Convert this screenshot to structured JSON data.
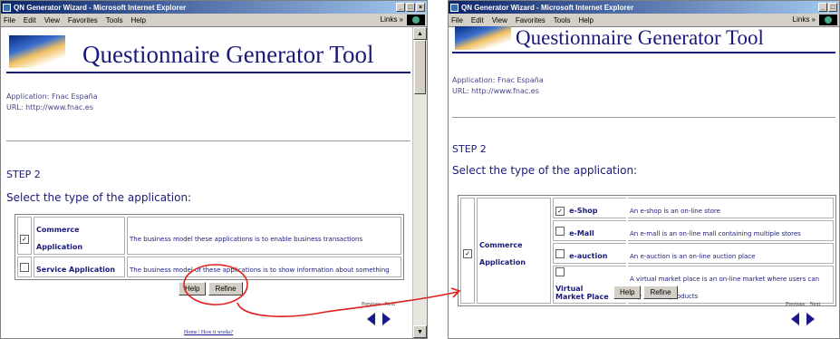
{
  "window": {
    "title": "QN Generator Wizard - Microsoft Internet Explorer",
    "menu": [
      "File",
      "Edit",
      "View",
      "Favorites",
      "Tools",
      "Help"
    ],
    "links_label": "Links »"
  },
  "page": {
    "header_title": "Questionnaire Generator Tool",
    "application_line": "Application: Fnac España",
    "url_line": "URL: http://www.fnac.es",
    "step": "STEP 2",
    "select_title": "Select the type of the application:"
  },
  "window1": {
    "rows": [
      {
        "checked": true,
        "name": "Commerce Application",
        "description": "The business model these applications is to enable business transactions"
      },
      {
        "checked": false,
        "name": "Service Application",
        "description": "The business model of these applications is to show information about something"
      }
    ],
    "buttons": {
      "help": "Help",
      "refine": "Refine"
    },
    "nav": {
      "previous": "Previous",
      "next": "Next"
    },
    "footer": {
      "home": "Home",
      "separator": "|",
      "how": "How it works?"
    }
  },
  "window2": {
    "main_row": {
      "checked": true,
      "name": "Commerce Application"
    },
    "subtypes": [
      {
        "checked": true,
        "name": "e-Shop",
        "description": "An e-shop is an on-line store"
      },
      {
        "checked": false,
        "name": "e-Mall",
        "description": "An e-mall is an on-line mall containing multiple stores"
      },
      {
        "checked": false,
        "name": "e-auction",
        "description": "An e-auction is an on-line auction place"
      },
      {
        "checked": false,
        "name": "Virtual Market Place",
        "description": "A virtual market place is an on-line market where users can buy and sell products"
      }
    ],
    "buttons": {
      "help": "Help",
      "refine": "Refine"
    },
    "nav": {
      "previous": "Previous",
      "next": "Next"
    }
  },
  "check_glyph": "☑",
  "colors": {
    "text_blue": "#1a1a7a",
    "annotation_red": "#e02020",
    "titlebar": "#0a246a"
  }
}
